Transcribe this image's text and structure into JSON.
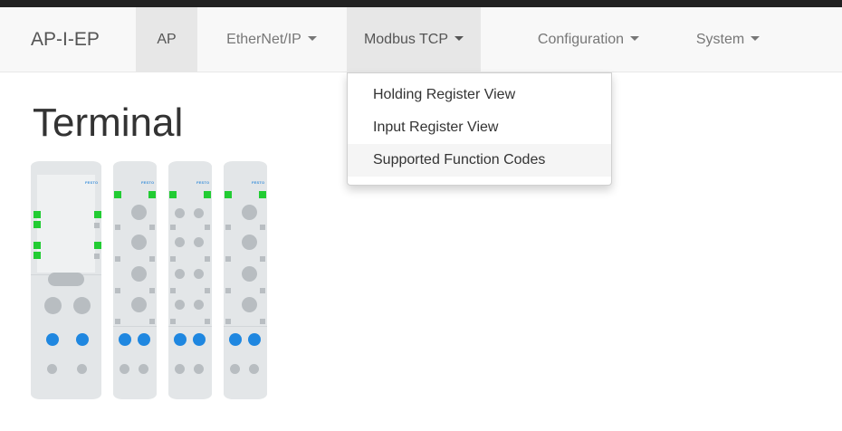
{
  "navbar": {
    "brand": "AP-I-EP",
    "items": [
      {
        "label": "AP",
        "active": true,
        "has_caret": false
      },
      {
        "label": "EtherNet/IP",
        "has_caret": true
      },
      {
        "label": "Modbus TCP",
        "has_caret": true,
        "open": true
      },
      {
        "label": "Configuration",
        "has_caret": true
      },
      {
        "label": "System",
        "has_caret": true
      }
    ]
  },
  "dropdown": {
    "items": [
      {
        "label": "Holding Register View"
      },
      {
        "label": "Input Register View"
      },
      {
        "label": "Supported Function Codes",
        "hovered": true
      }
    ]
  },
  "main": {
    "title": "Terminal",
    "module_logo": "FESTO"
  },
  "colors": {
    "navbar_bg": "#f8f8f8",
    "active_bg": "#e7e7e7",
    "led_green": "#22cc33",
    "button_blue": "#1f87e0",
    "module_grey": "#e3e6e8"
  }
}
